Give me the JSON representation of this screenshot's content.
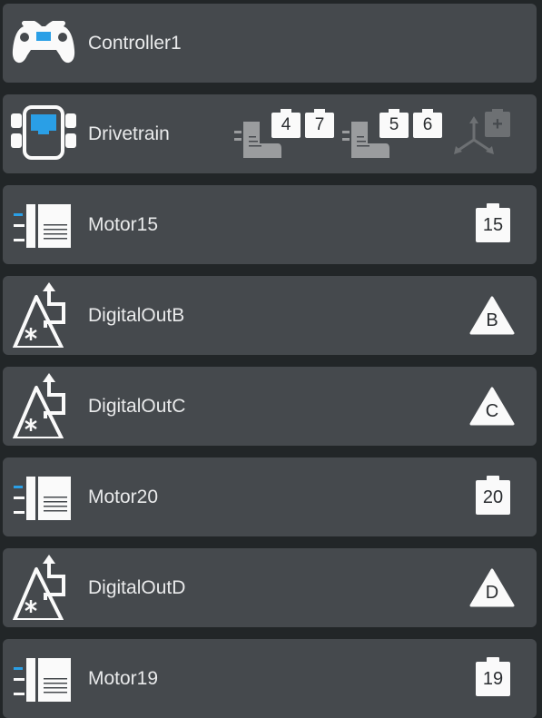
{
  "devices": [
    {
      "name": "Controller1",
      "icon": "controller-icon"
    },
    {
      "name": "Drivetrain",
      "icon": "drivetrain-icon",
      "left_motor_ports": [
        "4",
        "7"
      ],
      "right_motor_ports": [
        "5",
        "6"
      ],
      "gyro_add_label": "+"
    },
    {
      "name": "Motor15",
      "icon": "motor-icon",
      "port": "15"
    },
    {
      "name": "DigitalOutB",
      "icon": "digital-out-icon",
      "port": "B"
    },
    {
      "name": "DigitalOutC",
      "icon": "digital-out-icon",
      "port": "C"
    },
    {
      "name": "Motor20",
      "icon": "motor-icon",
      "port": "20"
    },
    {
      "name": "DigitalOutD",
      "icon": "digital-out-icon",
      "port": "D"
    },
    {
      "name": "Motor19",
      "icon": "motor-icon",
      "port": "19"
    }
  ],
  "colors": {
    "row_bg": "#45494d",
    "page_bg": "#222628",
    "accent": "#2a9fe6",
    "icon_grey": "#9a9c9e"
  }
}
